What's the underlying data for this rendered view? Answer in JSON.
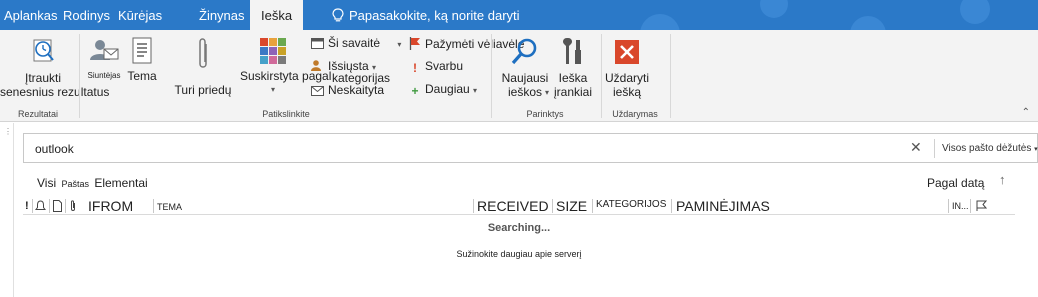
{
  "tabs": [
    {
      "label": "Aplankas"
    },
    {
      "label": "Rodinys"
    },
    {
      "label": "Kūrėjas"
    },
    {
      "label": "Žinynas"
    },
    {
      "label": "Ieška"
    }
  ],
  "tell_me": "Papasakokite, ką norite daryti",
  "ribbon": {
    "include_older_line1": "Įtraukti",
    "include_older_line2": "senesnius rezultatus",
    "group_results": "Rezultatai",
    "sent": "Siuntėjas",
    "subject": "Tema",
    "has_attachments": "Turi priedų",
    "categorized_line1": "Suskirstyta pagal",
    "categorized_line2": "kategorijas",
    "this_week": "Ši savaitė",
    "sent_to": "Išsiųsta",
    "unread": "Neskaityta",
    "flagged": "Pažymėti vėliavėle",
    "important": "Svarbu",
    "more": "Daugiau",
    "group_refine": "Patikslinkite",
    "recent_line1": "Naujausi",
    "recent_line2": "ieškos",
    "tools_line1": "Ieška",
    "tools_line2": "įrankiai",
    "group_options": "Parinktys",
    "close_line1": "Uždaryti",
    "close_line2": "iešką",
    "group_close": "Uždarymas"
  },
  "search": {
    "value": "outlook",
    "scope": "Visos pašto dėžutės"
  },
  "filters": {
    "all": "Visi",
    "mail": "Paštas",
    "items": "Elementai",
    "sort": "Pagal datą"
  },
  "columns": {
    "from": "IFROM",
    "subject": "TEMA",
    "received": "RECEIVED",
    "size": "SIZE",
    "categories": "KATEGORIJOS",
    "mentions": "PAMINĖJIMAS",
    "in": "IN..."
  },
  "status": {
    "searching": "Searching...",
    "more_on_server": "Sužinokite daugiau apie serverį"
  },
  "colors": {
    "tab_blue": "#2b79c8",
    "ribbon_bg": "#f3f3f3",
    "close_red": "#d9472b",
    "search_blue": "#1e6fc0"
  }
}
